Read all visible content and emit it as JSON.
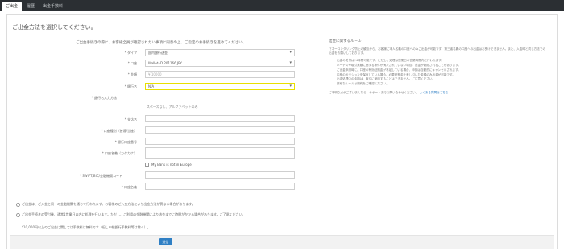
{
  "tabs": [
    "ご出金",
    "履歴",
    "出金手数料"
  ],
  "page_title": "ご出金方法を選択してください。",
  "intro": "ご出金手続きの際に、お客様全員が確認されたい事項に同意の上、ご指定のお手続きを進めてください。",
  "form": {
    "type_label": "* タイプ",
    "type_value": "国内銀行送金",
    "account_label": "* 口座",
    "account_value": "Wallet-ID 201166 JPY",
    "amount_label": "* 金額",
    "amount_placeholder": "¥ 10000",
    "bank_label": "* 銀行名",
    "bank_value": "N/A",
    "hint_label": "* 銀行名入力方法",
    "hint_text": "スペースなし、アルファベットのみ",
    "branch_label": "* 支店名",
    "branch_value": "",
    "account_type_label": "* 口座種別（普通/当座）",
    "account_type_value": "",
    "account_number_label": "* 銀行口座番号",
    "account_number_value": "",
    "holder_label": "* 口座名義（カタカナ）",
    "holder_value": "",
    "checkbox_label": "My Bank is not in Europe",
    "swift_label": "* SWIFT/BIC/金融機関コード",
    "swift_value": "",
    "swift_label2": "* 口座名義",
    "swift_value2": ""
  },
  "notes": [
    "ご出金は、ご入金と同一の金融機関を通じて行われます。お客様のご入金方法により出金方法が異なる場合があります。",
    "ご出金手続きの受付後、通常1営業日以内に処理を行います。ただし、ご利用の金融機関により着金までに時間がかかる場合があります。ご了承ください。",
    "*10,000円以上のご出金に関しては手数料は無料です（但し中継銀行手数料等は除く）。"
  ],
  "submit_label": "送信",
  "right": {
    "title": "出金に関するルール",
    "para": "マネーロンダリング防止の観点から、お客様ご本人名義の口座へのみご出金が可能です。第三者名義の口座への出金はお受けできません。また、入金時と同じ方法での出金をお願いしております。",
    "bullets": [
      "出金の受付は24時間可能です。ただし、処理は営業日の営業時間内に行われます。",
      "ボーナスや取引実績に関する条件が満たされていない場合、出金が制限されることがあります。",
      "ご出金申請時に、口座の有効証拠金が不足している場合、申請は自動的にキャンセルされます。",
      "口座のポジションを保有している場合、必要証拠金を差し引いた金額のみ出金が可能です。",
      "出金処理中の金額は、取引に使用することはできません。ご注意ください。",
      "詳細なルールは規約をご確認ください。"
    ],
    "footer_text": "ご不明な点がございましたら、サポートまでお問い合わせください。",
    "footer_link": "よくある質問はこちら"
  }
}
